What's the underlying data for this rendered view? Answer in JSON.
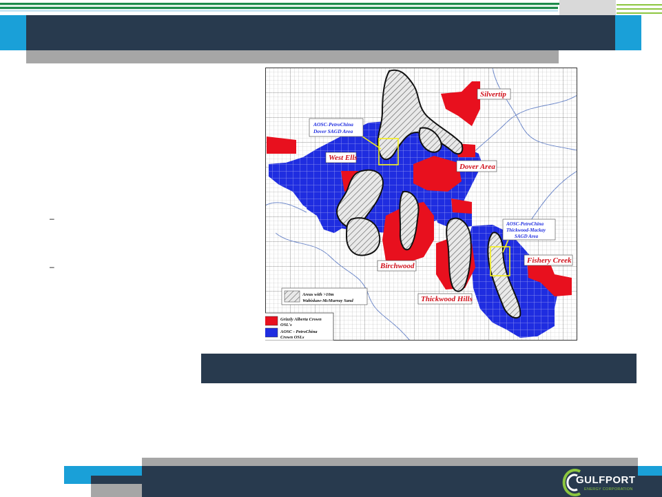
{
  "header": {
    "title": ""
  },
  "slide": {
    "bullet_marks": [
      "–",
      "–"
    ],
    "caption": ""
  },
  "map": {
    "labels": {
      "silvertip": "Silvertip",
      "west_ells": "West Ells",
      "dover_area": "Dover Area",
      "birchwood": "Birchwood",
      "thickwood_hills": "Thickwood Hills",
      "fishery_creek": "Fishery Creek",
      "dover_sagd_line1": "AOSC-PetroChina",
      "dover_sagd_line2": "Dover SAGD Area",
      "thickwood_sagd_line1": "AOSC-PetroChina",
      "thickwood_sagd_line2": "Thickwood-Mackay",
      "thickwood_sagd_line3": "SAGD Area"
    },
    "legend": {
      "sand_line1": "Areas with >10m",
      "sand_line2": "Wabiskaw-McMurray Sand",
      "red_line1": "Grizzly Alberta Crown",
      "red_line2": "OSL's",
      "blue_line1": "AOSC - PetroChina",
      "blue_line2": "Crown OSLs"
    },
    "colors": {
      "grizzly_red": "#e8101e",
      "petrochina_blue": "#1f2de0",
      "sagd_box": "#f5f01a",
      "label_red": "#d0101a"
    }
  },
  "footer": {
    "logo_text": "GULFPORT",
    "logo_subtext": "ENERGY CORPORATION"
  },
  "colors": {
    "brand_blue": "#1aa0d8",
    "dark_bar": "#283a4e",
    "green": "#1d8a4a",
    "gray_bar": "#a6a6a6"
  }
}
